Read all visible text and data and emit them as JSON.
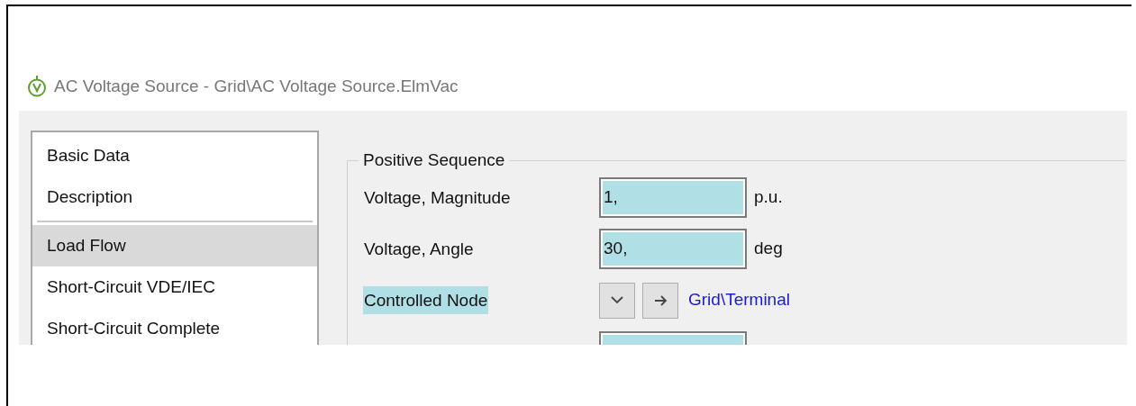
{
  "window": {
    "title": "AC Voltage Source - Grid\\AC Voltage Source.ElmVac"
  },
  "sidebar": {
    "items": [
      {
        "label": "Basic Data",
        "selected": false,
        "divider_after": false
      },
      {
        "label": "Description",
        "selected": false,
        "divider_after": true
      },
      {
        "label": "Load Flow",
        "selected": true,
        "divider_after": false
      },
      {
        "label": "Short-Circuit VDE/IEC",
        "selected": false,
        "divider_after": false
      },
      {
        "label": "Short-Circuit Complete",
        "selected": false,
        "divider_after": false
      }
    ]
  },
  "group": {
    "title": "Positive Sequence",
    "rows": [
      {
        "kind": "field",
        "label": "Voltage, Magnitude",
        "highlighted": false,
        "value": "1,",
        "unit": "p.u."
      },
      {
        "kind": "field",
        "label": "Voltage, Angle",
        "highlighted": false,
        "value": "30,",
        "unit": "deg"
      },
      {
        "kind": "link",
        "label": "Controlled Node",
        "highlighted": true,
        "link": "Grid\\Terminal"
      },
      {
        "kind": "field"
      }
    ]
  }
}
